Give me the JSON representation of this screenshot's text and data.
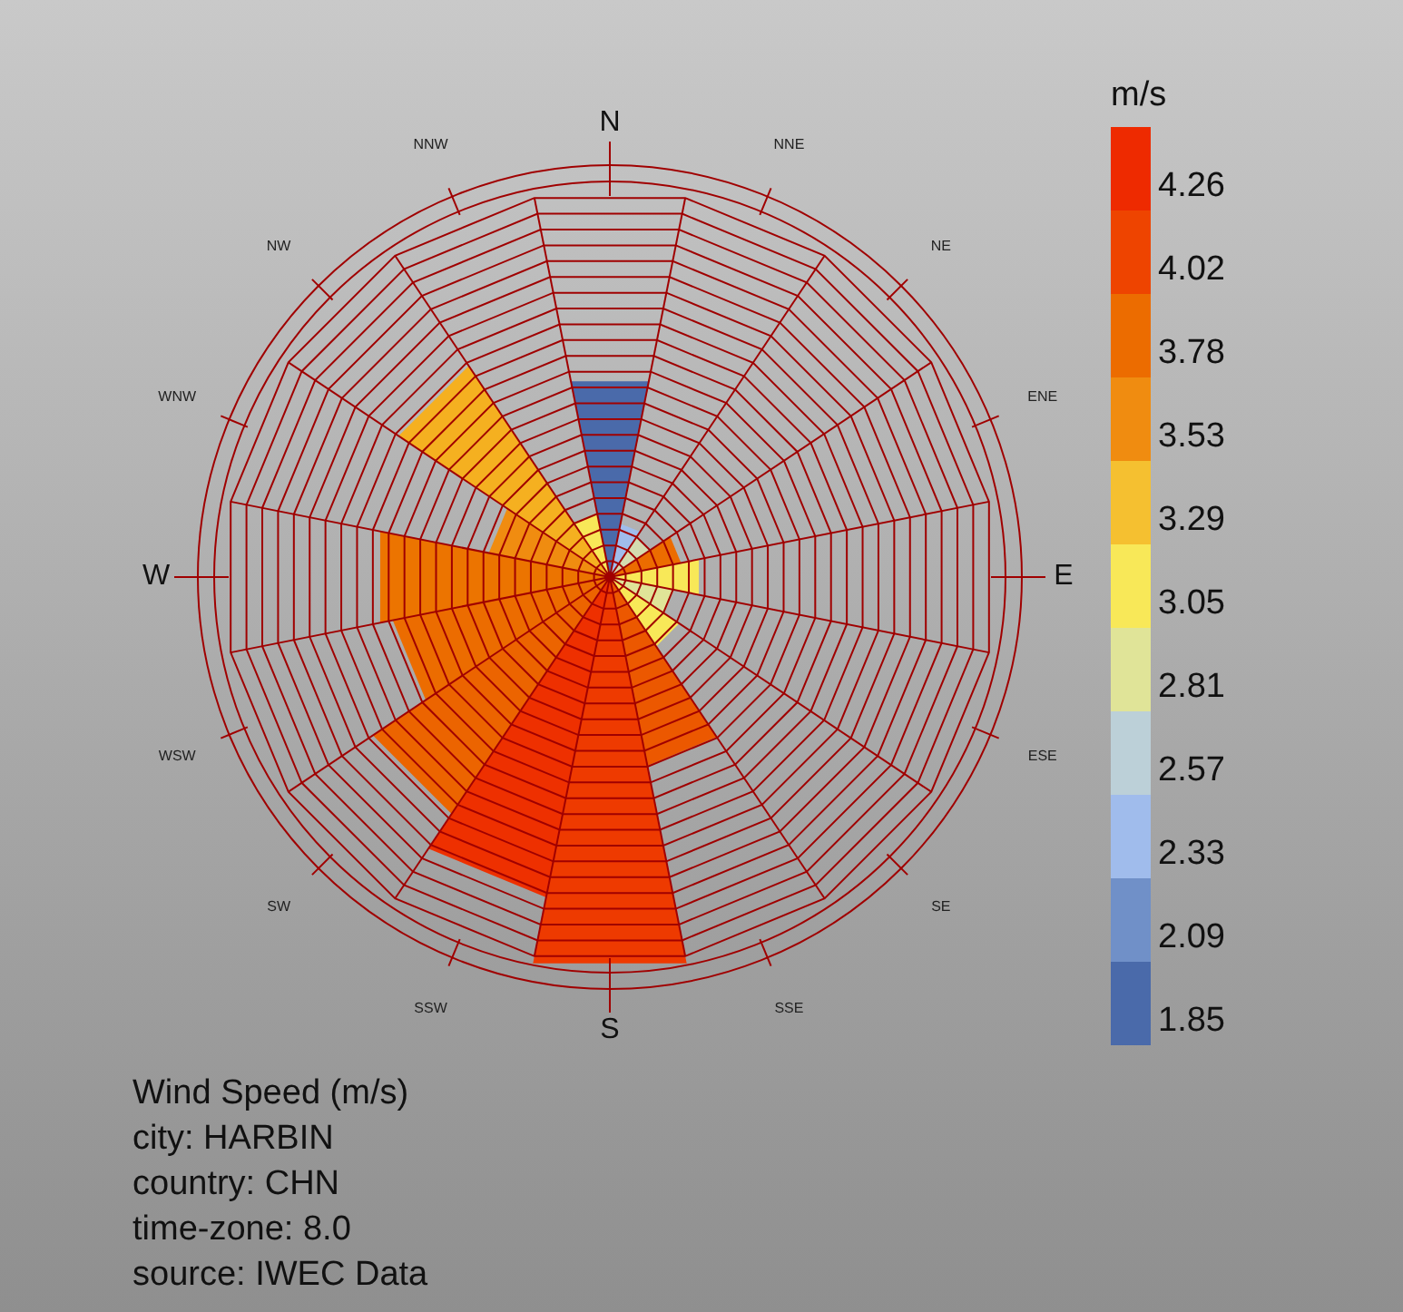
{
  "compass_labels": [
    {
      "label": "N",
      "kind": "major"
    },
    {
      "label": "NNE",
      "kind": "minor"
    },
    {
      "label": "NE",
      "kind": "minor"
    },
    {
      "label": "ENE",
      "kind": "minor"
    },
    {
      "label": "E",
      "kind": "major"
    },
    {
      "label": "ESE",
      "kind": "minor"
    },
    {
      "label": "SE",
      "kind": "minor"
    },
    {
      "label": "SSE",
      "kind": "minor"
    },
    {
      "label": "S",
      "kind": "major"
    },
    {
      "label": "SSW",
      "kind": "minor"
    },
    {
      "label": "SW",
      "kind": "minor"
    },
    {
      "label": "WSW",
      "kind": "minor"
    },
    {
      "label": "W",
      "kind": "major"
    },
    {
      "label": "WNW",
      "kind": "minor"
    },
    {
      "label": "NW",
      "kind": "minor"
    },
    {
      "label": "NNW",
      "kind": "minor"
    }
  ],
  "legend": {
    "title": "m/s",
    "items": [
      {
        "label": "4.26",
        "color": "#ee2a00"
      },
      {
        "label": "4.02",
        "color": "#ee4400"
      },
      {
        "label": "3.78",
        "color": "#ec6c00"
      },
      {
        "label": "3.53",
        "color": "#f08c10"
      },
      {
        "label": "3.29",
        "color": "#f5c030"
      },
      {
        "label": "3.05",
        "color": "#f8e858"
      },
      {
        "label": "2.81",
        "color": "#e0e498"
      },
      {
        "label": "2.57",
        "color": "#bcd0d8"
      },
      {
        "label": "2.33",
        "color": "#a0bcec"
      },
      {
        "label": "2.09",
        "color": "#7090c8"
      },
      {
        "label": "1.85",
        "color": "#4a6aaa"
      }
    ]
  },
  "info": [
    "Wind Speed (m/s)",
    "city: HARBIN",
    "country: CHN",
    "time-zone: 8.0",
    "source: IWEC Data"
  ]
}
